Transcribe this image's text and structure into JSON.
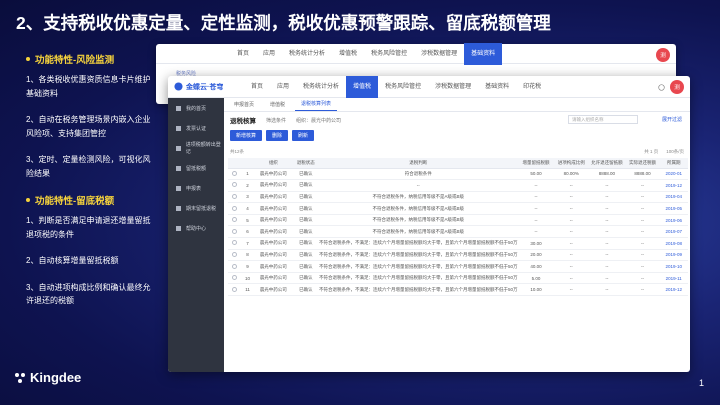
{
  "slide": {
    "title": "2、支持税收优惠定量、定性监测，税收优惠预警跟踪、留底税额管理",
    "page_number": "1",
    "logo_text": "Kingdee"
  },
  "left_panel": {
    "section1_title": "功能特性-风险监测",
    "section1_points": [
      "1、各类税收优惠资质信息卡片维护基础资料",
      "2、自动在税务管理场景内嵌入企业风险项、支持集团管控",
      "3、定时、定量检测风险，可视化风险结果"
    ],
    "section2_title": "功能特性-留底税额",
    "section2_points": [
      "1、判断是否满足申请退还增量留抵退项税的条件",
      "2、自动核算增量留抵税额",
      "3、自动进项构成比例和确认最终允许退还的税额"
    ]
  },
  "back_window": {
    "nav": [
      "首页",
      "应用",
      "税务统计分析",
      "增值税",
      "税务风险管控",
      "涉税数据管理",
      "基础资料"
    ],
    "active_nav": "基础资料",
    "breadcrumb": "税务风险",
    "avatar": "测"
  },
  "front_window": {
    "brand": "金蝶云·苍穹",
    "nav": [
      "首页",
      "应用",
      "税务统计分析",
      "增值税",
      "税务风险管控",
      "涉税数据管理",
      "基础资料",
      "印花税"
    ],
    "active_nav": "增值税",
    "avatar": "测",
    "sidebar": [
      "我的首页",
      "发票认证",
      "进项税额转出登记",
      "留抵税额",
      "申报表",
      "期末留抵退税",
      "帮助中心"
    ],
    "tabs": [
      "申报首页",
      "增值税",
      "退税核算列表"
    ],
    "active_tab": "退税核算列表",
    "section_title": "退税核算",
    "filter_label": "筛选条件",
    "filter_value": "组织：晨光中药公司",
    "search_placeholder": "请输入组织名称",
    "expand_label": "展开过滤",
    "buttons": [
      "新增核算",
      "删除",
      "刷新"
    ],
    "record_count": "共12条",
    "pagination": "共 1 页",
    "page_size": "100条/页",
    "columns": [
      "",
      "组织",
      "退税状态",
      "退税判断",
      "增量留抵税额",
      "进项构成比例",
      "允许退还留抵额",
      "实际退还税额",
      "所属期"
    ],
    "rows": [
      [
        "1",
        "晨光中药公司",
        "已确认",
        "符合退税条件",
        "50.00",
        "80.00%",
        "8888.00",
        "8888.00",
        "2020-01"
      ],
      [
        "2",
        "晨光中药公司",
        "已确认",
        "--",
        "--",
        "--",
        "--",
        "--",
        "2019-12"
      ],
      [
        "3",
        "晨光中药公司",
        "已确认",
        "不符合退税条件，纳税信用等级不是A级或B级",
        "--",
        "--",
        "--",
        "--",
        "2019-04"
      ],
      [
        "4",
        "晨光中药公司",
        "已确认",
        "不符合退税条件，纳税信用等级不是A级或B级",
        "--",
        "--",
        "--",
        "--",
        "2019-05"
      ],
      [
        "5",
        "晨光中药公司",
        "已确认",
        "不符合退税条件，纳税信用等级不是A级或B级",
        "--",
        "--",
        "--",
        "--",
        "2019-06"
      ],
      [
        "6",
        "晨光中药公司",
        "已确认",
        "不符合退税条件，纳税信用等级不是A级或B级",
        "--",
        "--",
        "--",
        "--",
        "2019-07"
      ],
      [
        "7",
        "晨光中药公司",
        "已确认",
        "不符合退税条件，不满足：连续六个月增量留抵税额均大于零，且第六个月增量留抵税额不低于50万",
        "30.00",
        "--",
        "--",
        "--",
        "2019-08"
      ],
      [
        "8",
        "晨光中药公司",
        "已确认",
        "不符合退税条件，不满足：连续六个月增量留抵税额均大于零，且第六个月增量留抵税额不低于50万",
        "20.00",
        "--",
        "--",
        "--",
        "2019-09"
      ],
      [
        "9",
        "晨光中药公司",
        "已确认",
        "不符合退税条件，不满足：连续六个月增量留抵税额均大于零，且第六个月增量留抵税额不低于50万",
        "40.00",
        "--",
        "--",
        "--",
        "2019-10"
      ],
      [
        "10",
        "晨光中药公司",
        "已确认",
        "不符合退税条件，不满足：连续六个月增量留抵税额均大于零，且第六个月增量留抵税额不低于50万",
        "5.00",
        "--",
        "--",
        "--",
        "2019-11"
      ],
      [
        "11",
        "晨光中药公司",
        "已确认",
        "不符合退税条件，不满足：连续六个月增量留抵税额均大于零，且第六个月增量留抵税额不低于50万",
        "10.00",
        "--",
        "--",
        "--",
        "2019-12"
      ]
    ]
  },
  "colors": {
    "accent": "#2d5bd9",
    "highlight": "#f5d23c",
    "sidebar": "#2f3440"
  }
}
